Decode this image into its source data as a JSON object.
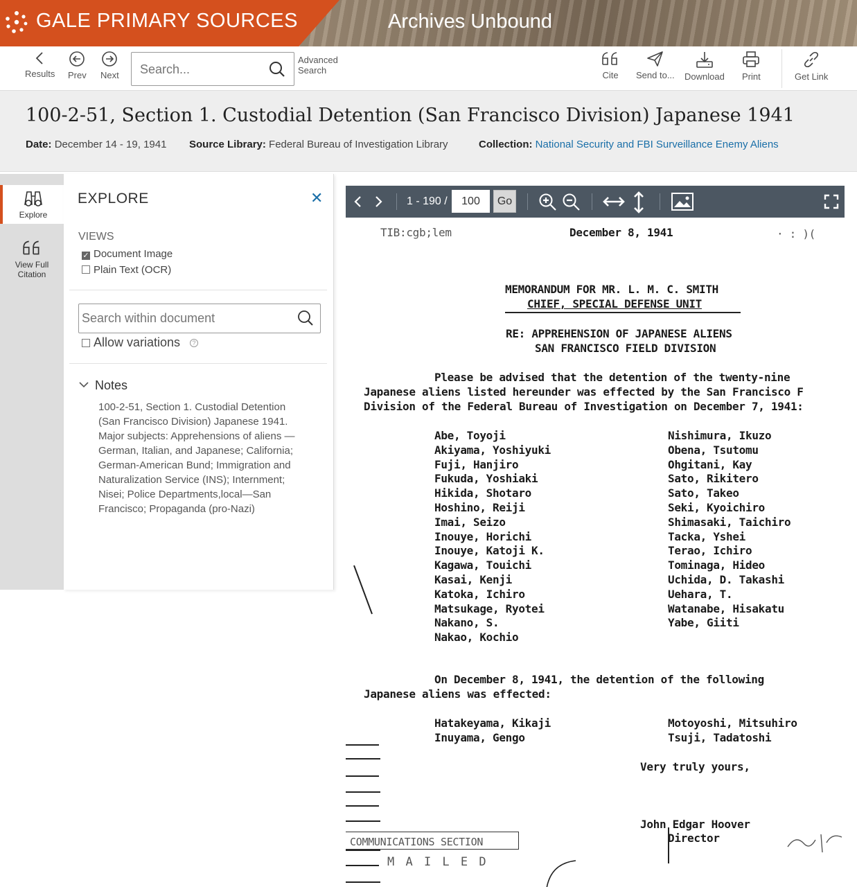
{
  "banner": {
    "brand": "GALE PRIMARY SOURCES",
    "product": "Archives Unbound"
  },
  "toolbar": {
    "results": "Results",
    "prev": "Prev",
    "next": "Next",
    "search_placeholder": "Search...",
    "advanced_line1": "Advanced",
    "advanced_line2": "Search",
    "cite": "Cite",
    "send_to": "Send to...",
    "download": "Download",
    "print": "Print",
    "get_link": "Get Link"
  },
  "document": {
    "title": "100-2-51, Section 1. Custodial Detention (San Francisco Division) Japanese 1941",
    "date_label": "Date:",
    "date": "December 14 - 19, 1941",
    "source_label": "Source Library:",
    "source": "Federal Bureau of Investigation Library",
    "collection_label": "Collection:",
    "collection": "National Security and FBI Surveillance Enemy Aliens"
  },
  "side_tabs": {
    "explore": "Explore",
    "citation_line1": "View Full",
    "citation_line2": "Citation"
  },
  "explore": {
    "title": "EXPLORE",
    "views_label": "VIEWS",
    "view_document_image": "Document Image",
    "view_plain_text": "Plain Text (OCR)",
    "search_placeholder": "Search within document",
    "allow_variations": "Allow variations",
    "notes_label": "Notes",
    "notes_text": "100-2-51, Section 1. Custodial Detention (San Francisco Division) Japanese 1941. Major subjects: Apprehensions of aliens — German, Italian, and Japanese; California; German-American Bund; Immigration and Naturalization Service (INS); Internment; Nisei; Police Departments,local—San Francisco; Propaganda (pro-Nazi)"
  },
  "viewer": {
    "page_range": "1 - 190 /",
    "page_value": "100",
    "go": "Go"
  },
  "scan": {
    "ref": "TIB:cgb;lem",
    "date": "December 8, 1941",
    "memo_line1": "MEMORANDUM FOR MR. L. M. C. SMITH",
    "memo_line2": "CHIEF, SPECIAL DEFENSE UNIT",
    "re_line1": "RE: APPREHENSION OF JAPANESE ALIENS",
    "re_line2": "SAN FRANCISCO FIELD DIVISION",
    "para1_line1": "Please be advised that the detention of the twenty-nine",
    "para1_line2": "Japanese aliens listed hereunder was effected by the San Francisco F",
    "para1_line3": "Division of the Federal Bureau of Investigation on December 7, 1941:",
    "names_left": "Abe, Toyoji\nAkiyama, Yoshiyuki\nFuji, Hanjiro\nFukuda, Yoshiaki\nHikida, Shotaro\nHoshino, Reiji\nImai, Seizo\nInouye, Horichi\nInouye, Katoji K.\nKagawa, Touichi\nKasai, Kenji\nKatoka, Ichiro\nMatsukage, Ryotei\nNakano, S.\nNakao, Kochio",
    "names_right": "Nishimura, Ikuzo\nObena, Tsutomu\nOhgitani, Kay\nSato, Rikitero\nSato, Takeo\nSeki, Kyoichiro\nShimasaki, Taichiro\nTacka, Yshei\nTerao, Ichiro\nTominaga, Hideo\nUchida, D. Takashi\nUehara, T.\nWatanabe, Hisakatu\nYabe, Giiti",
    "para2_line1": "On December 8, 1941, the detention of the following",
    "para2_line2": "Japanese aliens was effected:",
    "names2_left": "Hatakeyama, Kikaji\nInuyama, Gengo",
    "names2_right": "Motoyoshi, Mitsuhiro\nTsuji, Tadatoshi",
    "closing": "Very truly yours,",
    "signature": "John Edgar Hoover",
    "sig_title": "Director",
    "stamp_line1": "COMMUNICATIONS SECTION",
    "stamp_line2": "M A I L E D"
  },
  "colors": {
    "brand": "#d4501e",
    "link": "#1a6fa8",
    "viewer_bar": "#4c5762"
  }
}
